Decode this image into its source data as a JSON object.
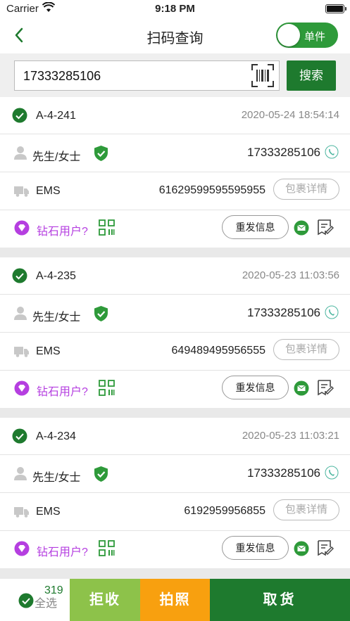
{
  "status_bar": {
    "carrier": "Carrier",
    "time": "9:18 PM"
  },
  "nav": {
    "title": "扫码查询",
    "toggle_label": "单件"
  },
  "search": {
    "value": "17333285106",
    "button_label": "搜索"
  },
  "colors": {
    "brand_green": "#1e7a2e",
    "toggle_green": "#2e9a3a",
    "reject": "#8dc24a",
    "photo": "#f8a00f",
    "vip_purple": "#b53fe0"
  },
  "orders": [
    {
      "code": "A-4-241",
      "datetime": "2020-05-24 18:54:14",
      "name": "先生/女士",
      "phone": "17333285106",
      "carrier": "EMS",
      "tracking": "61629599595595955",
      "detail_label": "包裹详情",
      "vip_label": "钻石用户?",
      "resend_label": "重发信息"
    },
    {
      "code": "A-4-235",
      "datetime": "2020-05-23 11:03:56",
      "name": "先生/女士",
      "phone": "17333285106",
      "carrier": "EMS",
      "tracking": "649489495956555",
      "detail_label": "包裹详情",
      "vip_label": "钻石用户?",
      "resend_label": "重发信息"
    },
    {
      "code": "A-4-234",
      "datetime": "2020-05-23 11:03:21",
      "name": "先生/女士",
      "phone": "17333285106",
      "carrier": "EMS",
      "tracking": "6192959956855",
      "detail_label": "包裹详情",
      "vip_label": "钻石用户?",
      "resend_label": "重发信息"
    }
  ],
  "bottom": {
    "select_all": "全选",
    "count": "319",
    "reject": "拒收",
    "photo": "拍照",
    "pickup": "取货"
  }
}
